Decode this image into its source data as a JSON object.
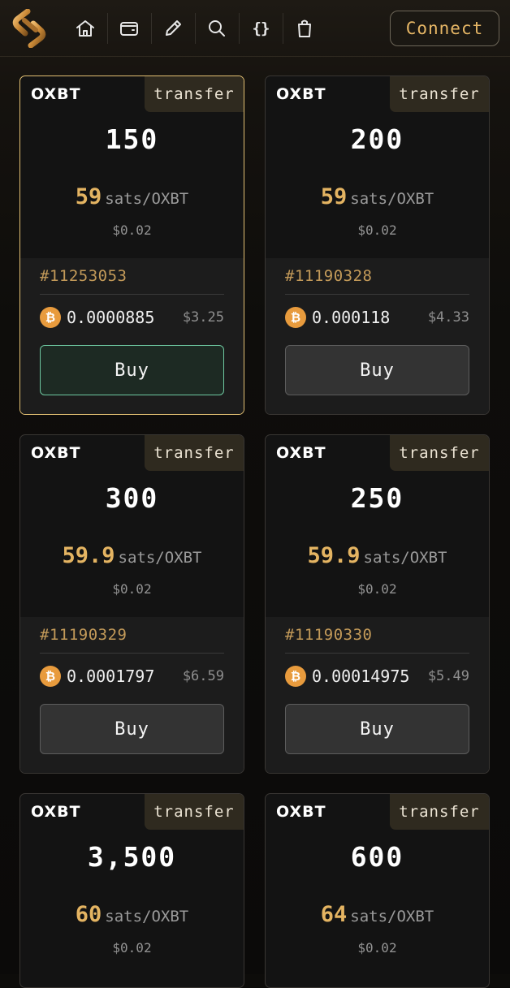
{
  "header": {
    "nav_icons": [
      "home-icon",
      "wallet-icon",
      "pencil-icon",
      "search-icon",
      "braces-icon",
      "shopping-bag-icon"
    ],
    "braces_text": "{}",
    "connect_label": "Connect"
  },
  "colors": {
    "accent": "#e4b462",
    "selected_border": "#e3c073",
    "buy_active_border": "#6ec7a0",
    "btc": "#e89b3d"
  },
  "cards": [
    {
      "ticker": "OXBT",
      "tag": "transfer",
      "amount": "150",
      "price": "59",
      "unit": "sats/OXBT",
      "usd_unit": "$0.02",
      "inscription": "#11253053",
      "btc_symbol": "₿",
      "btc": "0.0000885",
      "usd": "$3.25",
      "buy": "Buy",
      "selected": true
    },
    {
      "ticker": "OXBT",
      "tag": "transfer",
      "amount": "200",
      "price": "59",
      "unit": "sats/OXBT",
      "usd_unit": "$0.02",
      "inscription": "#11190328",
      "btc_symbol": "₿",
      "btc": "0.000118",
      "usd": "$4.33",
      "buy": "Buy",
      "selected": false
    },
    {
      "ticker": "OXBT",
      "tag": "transfer",
      "amount": "300",
      "price": "59.9",
      "unit": "sats/OXBT",
      "usd_unit": "$0.02",
      "inscription": "#11190329",
      "btc_symbol": "₿",
      "btc": "0.0001797",
      "usd": "$6.59",
      "buy": "Buy",
      "selected": false
    },
    {
      "ticker": "OXBT",
      "tag": "transfer",
      "amount": "250",
      "price": "59.9",
      "unit": "sats/OXBT",
      "usd_unit": "$0.02",
      "inscription": "#11190330",
      "btc_symbol": "₿",
      "btc": "0.00014975",
      "usd": "$5.49",
      "buy": "Buy",
      "selected": false
    },
    {
      "ticker": "OXBT",
      "tag": "transfer",
      "amount": "3,500",
      "price": "60",
      "unit": "sats/OXBT",
      "usd_unit": "$0.02"
    },
    {
      "ticker": "OXBT",
      "tag": "transfer",
      "amount": "600",
      "price": "64",
      "unit": "sats/OXBT",
      "usd_unit": "$0.02"
    }
  ]
}
